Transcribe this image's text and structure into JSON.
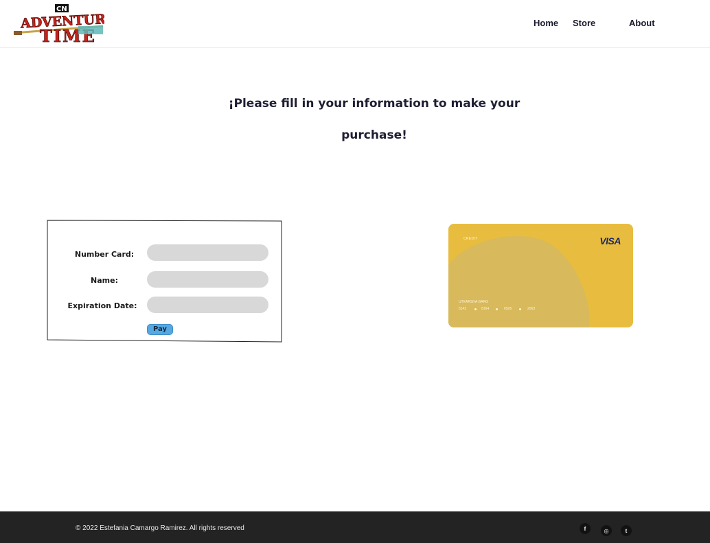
{
  "header": {
    "logo_alt": "Cartoon Network Adventure Time logo",
    "nav": [
      {
        "label": "Home"
      },
      {
        "label": "Store"
      },
      {
        "label": "About"
      }
    ]
  },
  "main": {
    "heading": "¡Please fill in your information to make your purchase!"
  },
  "form": {
    "fields": [
      {
        "label": "Number Card:",
        "value": "",
        "placeholder": ""
      },
      {
        "label": "Name:",
        "value": "",
        "placeholder": ""
      },
      {
        "label": "Expiration Date:",
        "value": "",
        "placeholder": ""
      }
    ],
    "pay_label": "Pay"
  },
  "card": {
    "type": "CREDIT",
    "brand": "VISA",
    "holder": "UTKARSHA GARG",
    "number_groups": [
      "5142",
      "8164",
      "6526",
      "2563"
    ],
    "color": "#e8bd3f"
  },
  "footer": {
    "copyright": "© 2022 Estefania Camargo Ramirez. All rights reserved",
    "social": [
      {
        "name": "facebook-icon",
        "glyph": "f"
      },
      {
        "name": "instagram-icon",
        "glyph": "◎"
      },
      {
        "name": "twitter-icon",
        "glyph": "t"
      }
    ]
  }
}
